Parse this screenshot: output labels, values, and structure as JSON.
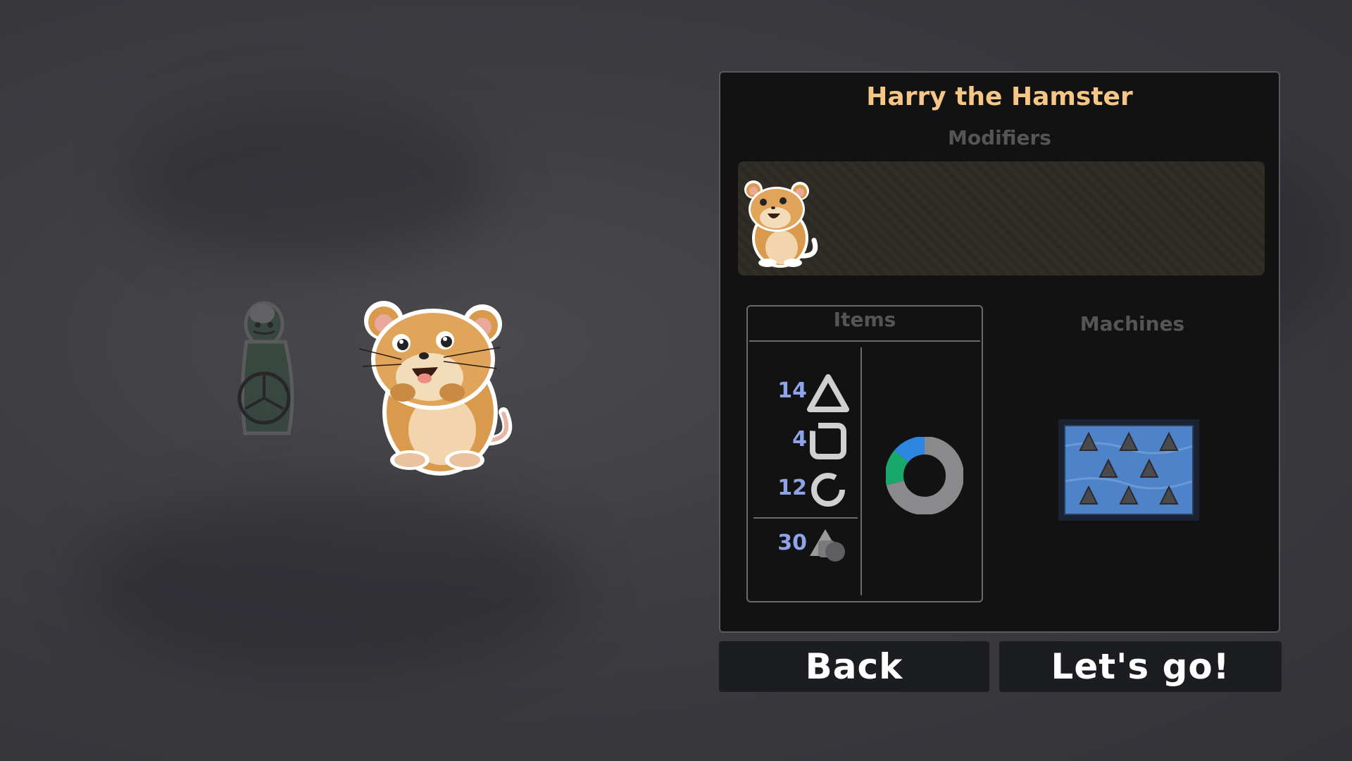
{
  "panel": {
    "character_name": "Harry the Hamster",
    "modifiers_label": "Modifiers",
    "items_label": "Items",
    "machines_label": "Machines",
    "items": [
      {
        "count": "14",
        "icon": "triangle-icon"
      },
      {
        "count": "4",
        "icon": "square-icon"
      },
      {
        "count": "12",
        "icon": "circle-icon"
      },
      {
        "count": "30",
        "icon": "mixed-shapes-icon"
      }
    ],
    "item_mix": {
      "segments": [
        {
          "name": "green",
          "fraction": 0.15,
          "color": "#18a86b"
        },
        {
          "name": "blue",
          "fraction": 0.14,
          "color": "#2f86e0"
        },
        {
          "name": "gray",
          "fraction": 0.71,
          "color": "#8a8a8c"
        }
      ]
    }
  },
  "buttons": {
    "back": "Back",
    "go": "Let's go!"
  },
  "colors": {
    "title": "#f6c687",
    "count": "#8ea3e8",
    "panel_bg": "#121213",
    "machine_water": "#4f83c9"
  }
}
